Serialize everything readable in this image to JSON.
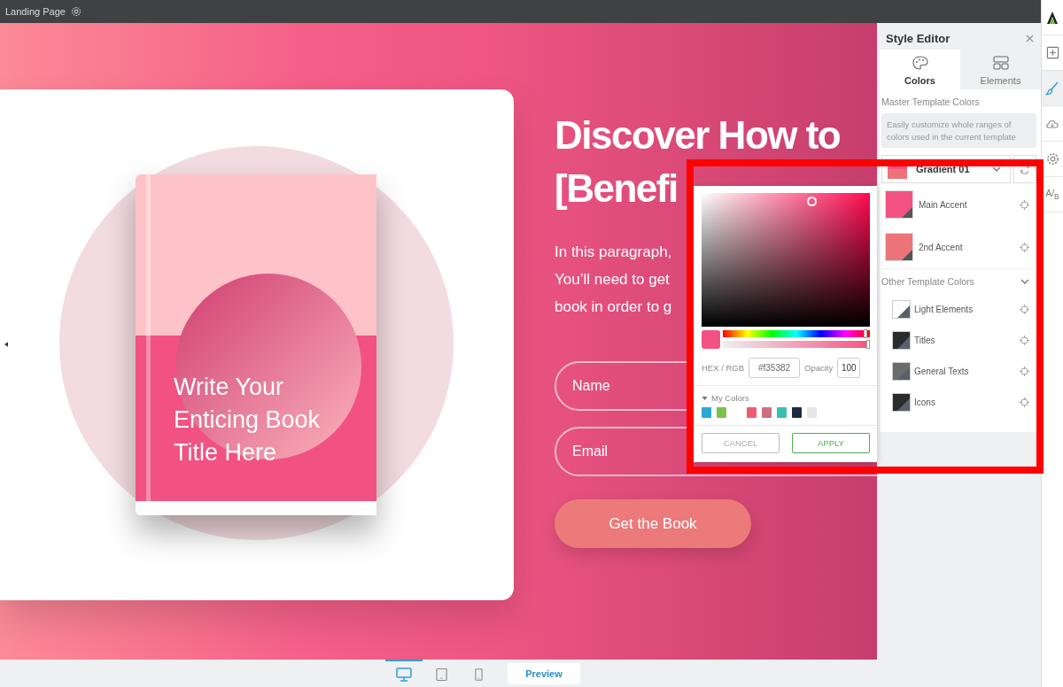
{
  "topbar": {
    "breadcrumb": "Landing Page"
  },
  "toolbar": {
    "items": [
      {
        "kind": "logo",
        "selected": false
      },
      {
        "kind": "add",
        "selected": false
      },
      {
        "kind": "brush",
        "selected": true
      },
      {
        "kind": "cloud",
        "selected": false
      },
      {
        "kind": "settings",
        "selected": false
      },
      {
        "kind": "ab",
        "selected": false,
        "label": "A/$_{B}$"
      }
    ]
  },
  "canvas": {
    "book_title": "Write Your Enticing Book Title Here",
    "headline": [
      "Discover How to",
      "[Benefi"
    ],
    "paragraph": [
      "In this paragraph,",
      "You’ll need to get",
      "book in order to g"
    ],
    "fields": [
      {
        "placeholder": "Name"
      },
      {
        "placeholder": "Email"
      }
    ],
    "cta": "Get the Book"
  },
  "device_bar": {
    "devices": [
      {
        "kind": "desktop",
        "selected": true
      },
      {
        "kind": "tablet",
        "selected": false
      },
      {
        "kind": "phone",
        "selected": false
      }
    ],
    "preview": "Preview"
  },
  "style_editor": {
    "title": "Style Editor",
    "tabs": [
      {
        "label": "Colors",
        "kind": "palette",
        "selected": true
      },
      {
        "label": "Elements",
        "kind": "layout",
        "selected": false
      }
    ],
    "section": "Master Template Colors",
    "hint": "Easily customize whole ranges of colors used in the current template",
    "preset": "Gradient 01",
    "main_colors": [
      {
        "label": "Main Accent",
        "color": "#f35382"
      },
      {
        "label": "2nd Accent",
        "color": "#ec7479"
      }
    ],
    "other_title": "Other Template Colors",
    "other_expanded": true,
    "other_colors": [
      {
        "label": "Light Elements",
        "color": "#ffffff"
      },
      {
        "label": "Titles",
        "color": "#2b2b2b"
      },
      {
        "label": "General Texts",
        "color": "#6b6b6b"
      },
      {
        "label": "Icons",
        "color": "#2b2b2b"
      }
    ]
  },
  "color_picker": {
    "hex_label": "HEX / RGB",
    "hex": "#f35382",
    "opacity_label": "Opacity",
    "opacity": "100",
    "hue": {
      "level": 0.97
    },
    "alpha": {
      "level": 1
    },
    "my_colors_title": "My Colors",
    "swatches": [
      {
        "color": "#29a8d8"
      },
      {
        "color": "#7bc24a"
      },
      {
        "color": "#f05a6e"
      },
      {
        "color": "#c9707e"
      },
      {
        "color": "#3bbfb4"
      },
      {
        "color": "#1b2b42"
      },
      {
        "color": "#e6e6e6"
      }
    ],
    "cancel": "CANCEL",
    "apply": "APPLY"
  }
}
